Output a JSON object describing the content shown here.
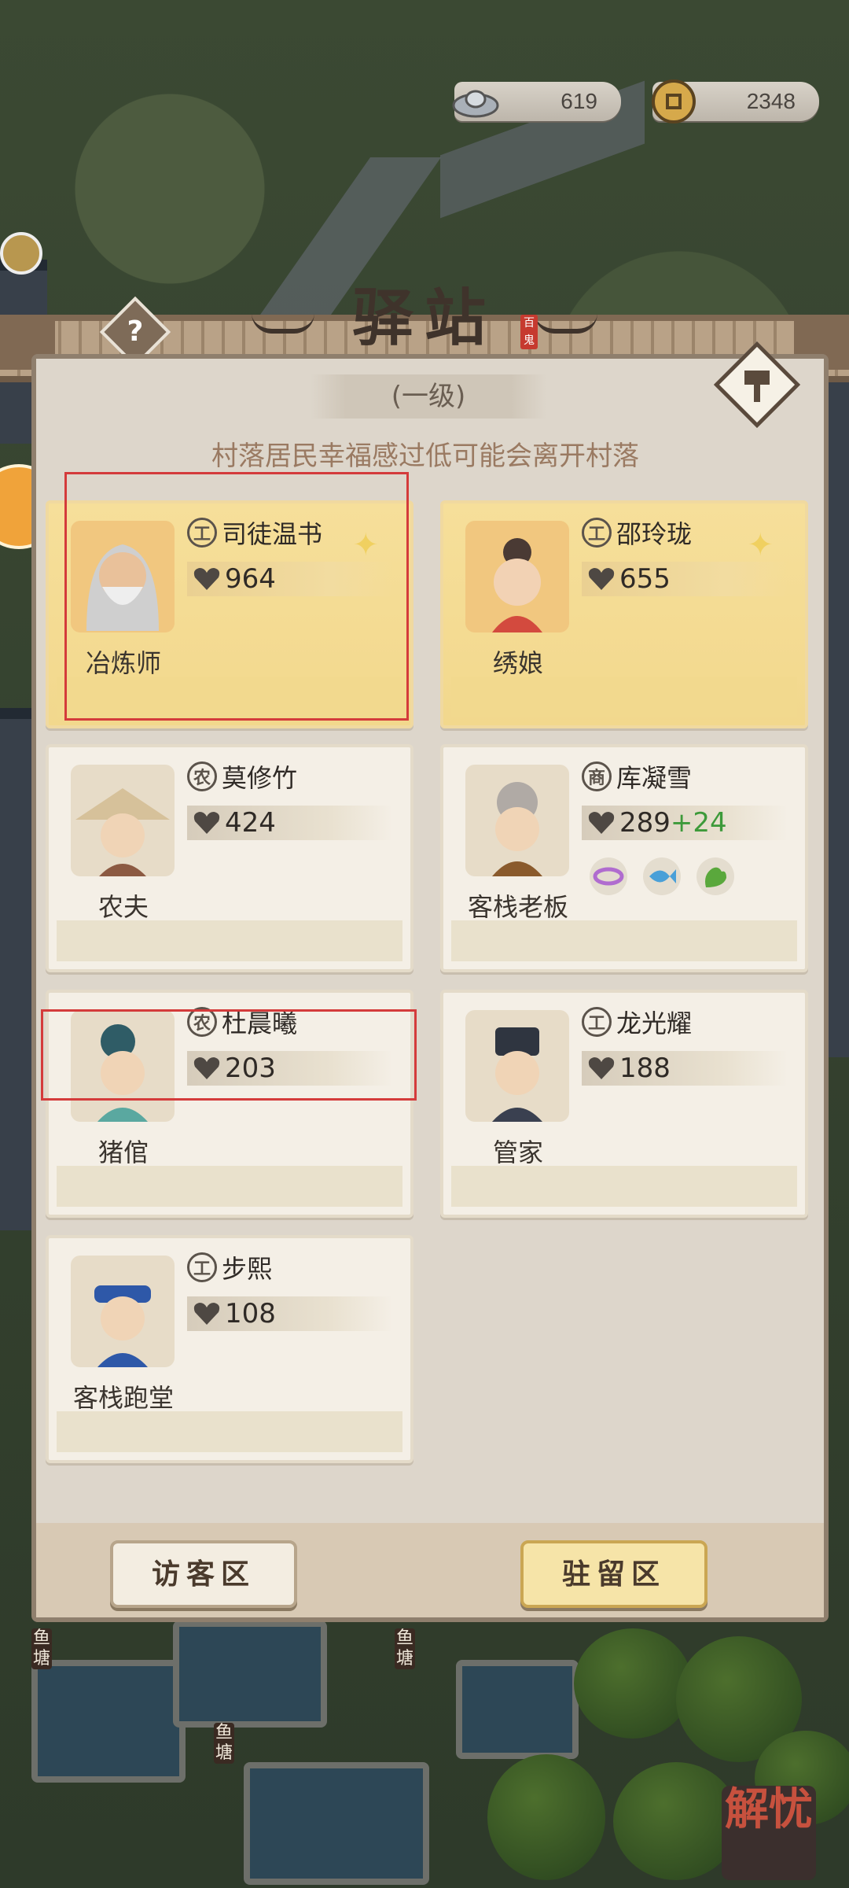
{
  "currency": {
    "silver": "619",
    "copper": "2348"
  },
  "panel": {
    "title": "驿站",
    "seal_text": "百鬼",
    "level": "(一级)",
    "notice": "村落居民幸福感过低可能会离开村落"
  },
  "residents": [
    {
      "name": "司徒温书",
      "badge": "工",
      "stat": "964",
      "bonus": "",
      "job": "冶炼师",
      "highlighted": true
    },
    {
      "name": "邵玲珑",
      "badge": "工",
      "stat": "655",
      "bonus": "",
      "job": "绣娘",
      "highlighted": true
    },
    {
      "name": "莫修竹",
      "badge": "农",
      "stat": "424",
      "bonus": "",
      "job": "农夫"
    },
    {
      "name": "库凝雪",
      "badge": "商",
      "stat": "289",
      "bonus": "+24",
      "job": "客栈老板",
      "buffs": [
        "ring-icon",
        "fish-icon",
        "muscle-icon"
      ]
    },
    {
      "name": "杜晨曦",
      "badge": "农",
      "stat": "203",
      "bonus": "",
      "job": "猪倌"
    },
    {
      "name": "龙光耀",
      "badge": "工",
      "stat": "188",
      "bonus": "",
      "job": "管家"
    },
    {
      "name": "步熙",
      "badge": "工",
      "stat": "108",
      "bonus": "",
      "job": "客栈跑堂"
    }
  ],
  "footer": {
    "visitor_label": "访客区",
    "stay_label": "驻留区"
  },
  "map_labels": {
    "fish_pond": "鱼塘",
    "corner_seal": "解忧"
  },
  "colors": {
    "highlight": "#d43b3b",
    "gold_card": "#f6df9a",
    "bonus_green": "#3d9a3a"
  }
}
